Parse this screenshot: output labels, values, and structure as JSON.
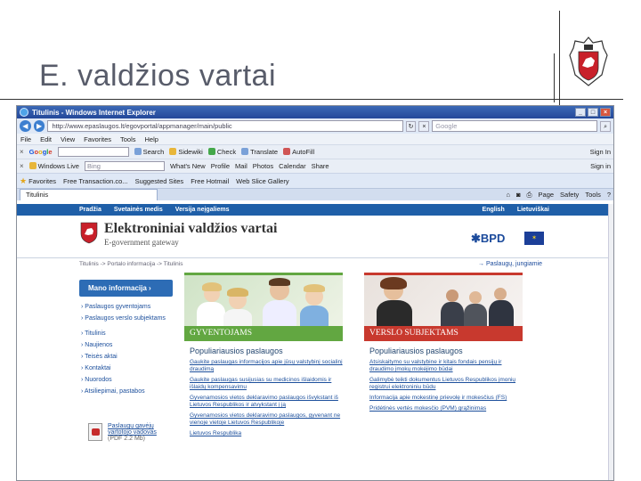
{
  "slide": {
    "title": "E. valdžios vartai"
  },
  "browser": {
    "window_title": "Titulinis - Windows Internet Explorer",
    "address": "http://www.epaslaugos.lt/egovportal/appmanager/main/public",
    "search_placeholder": "Google",
    "menu": [
      "File",
      "Edit",
      "View",
      "Favorites",
      "Tools",
      "Help"
    ],
    "google_toolbar": {
      "logo_parts": [
        "G",
        "o",
        "o",
        "g",
        "l",
        "e"
      ],
      "items": [
        "Search",
        "Sidewiki",
        "Check",
        "Translate",
        "AutoFill"
      ],
      "signin": "Sign In"
    },
    "live_toolbar": {
      "label": "Windows Live",
      "input": "Bing",
      "items": [
        "What's New",
        "Profile",
        "Mail",
        "Photos",
        "Calendar",
        "Share"
      ],
      "signin": "Sign in"
    },
    "favorites_bar": {
      "label": "Favorites",
      "items": [
        "Free Transaction.co...",
        "Suggested Sites",
        "Free Hotmail",
        "Web Slice Gallery"
      ]
    },
    "tab": "Titulinis",
    "command_bar": [
      "Page",
      "Safety",
      "Tools"
    ]
  },
  "site": {
    "topnav": [
      "Pradžia",
      "Svetainės medis",
      "Versija neįgaliems"
    ],
    "lang": [
      "English",
      "Lietuviškai"
    ],
    "title": "Elektroniniai valdžios vartai",
    "subtitle": "E-government gateway",
    "bpd": "BPD",
    "crumbs": "Titulinis -> Portalo informacija -> Titulinis",
    "login": "→ Paslaugų, jungiamie",
    "mano": "Mano informacija",
    "left_top": [
      "Paslaugos gyventojams",
      "Paslaugos verslo subjektams"
    ],
    "left_links": [
      "Titulinis",
      "Naujienos",
      "Teisės aktai",
      "Kontaktai",
      "Nuorodos",
      "Atsiliepimai, pastabos"
    ],
    "pdf": {
      "title": "Paslaugų gavėjų vartotojo vadovas",
      "size": "(PDF 2.2 Mb)"
    },
    "citizens": {
      "banner": "GYVENTOJAMS",
      "heading": "Populiariausios paslaugos",
      "links": [
        "Gaukite paslaugas informacijos apie jūsų valstybinį socialinį draudimą",
        "Gaukite paslaugas susijusias su medicinos išlaidomis ir išlaidų kompensavimu",
        "Gyvenamosios vietos deklaravimo paslaugos išvykstant iš Lietuvos Respublikos ir atvykstant į ją",
        "Gyvenamosios vietos deklaravimo paslaugos, gyvenant ne vienoje vietoje Lietuvos Respublikoje",
        "Lietuvos Respublika"
      ]
    },
    "business": {
      "banner": "VERSLO SUBJEKTAMS",
      "heading": "Populiariausios paslaugos",
      "links": [
        "Atsiskaitymo su valstybine ir kitais fondais pensijų ir draudimo įmokų mokėjimo būdai",
        "Galimybė teikti dokumentus Lietuvos Respublikos įmonių registrui elektroniniu būdu",
        "Informacija apie mokestinę prievolę ir mokesčius (FS)",
        "Pridėtinės vertės mokesčio (PVM) grąžinimas"
      ]
    }
  }
}
